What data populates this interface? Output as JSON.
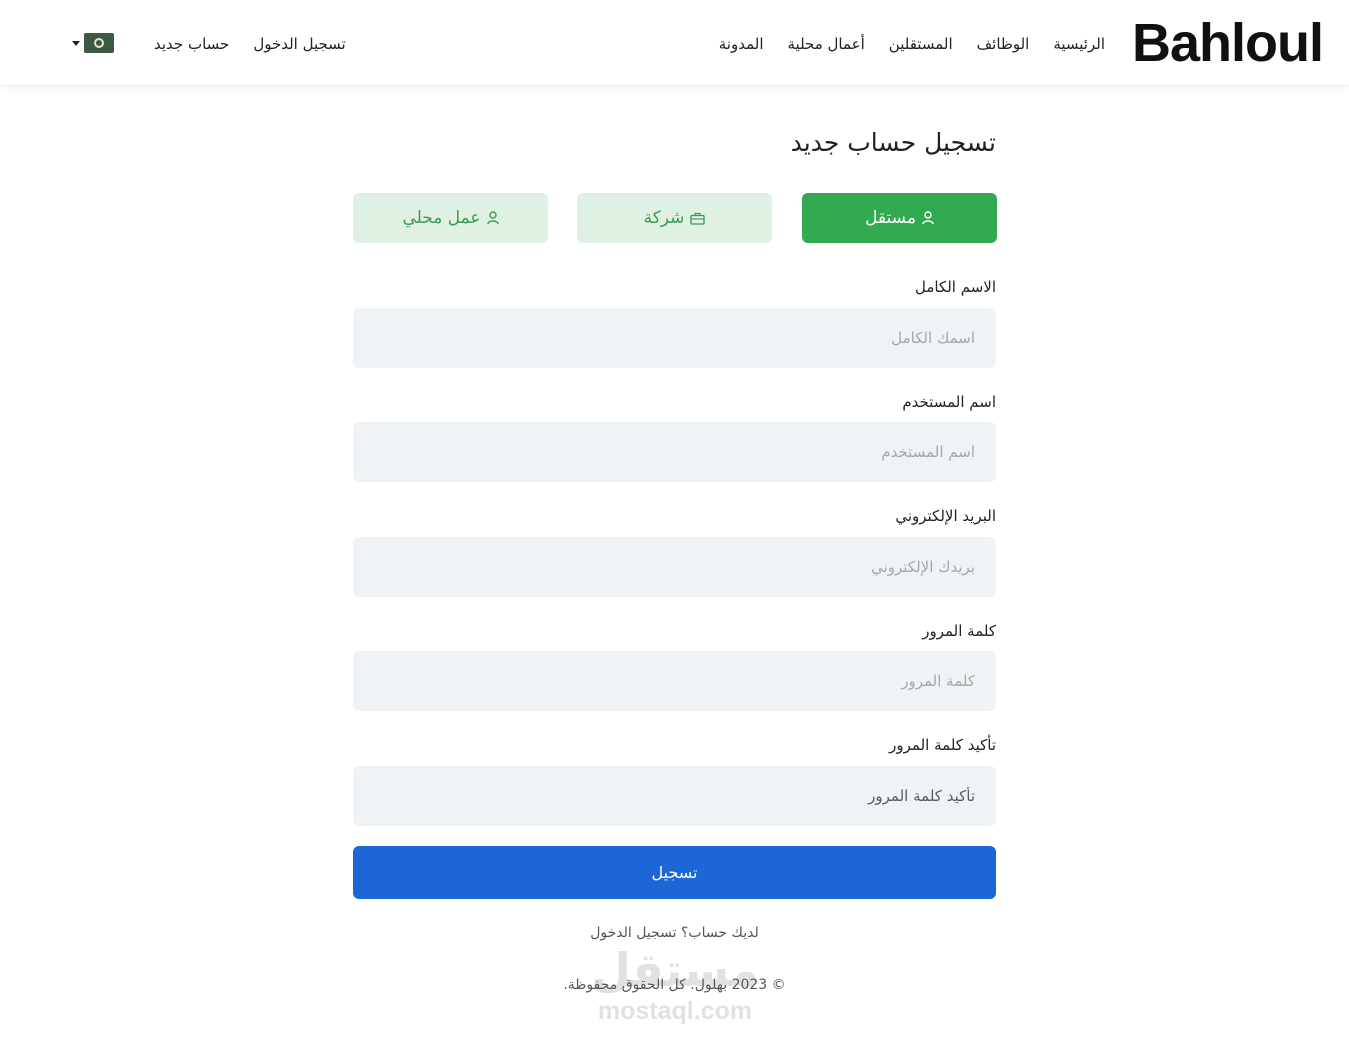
{
  "header": {
    "logo_text": "Bahloul",
    "nav": [
      {
        "label": "الرئيسية"
      },
      {
        "label": "الوظائف"
      },
      {
        "label": "المستقلين"
      },
      {
        "label": "أعمال محلية"
      },
      {
        "label": "المدونة"
      }
    ],
    "auth": {
      "login": "تسجيل الدخول",
      "register": "حساب جديد"
    },
    "language": {
      "flag_icon": "arabic-flag-icon"
    }
  },
  "page": {
    "title": "تسجيل حساب جديد"
  },
  "account_types": [
    {
      "label": "مستقل",
      "icon": "user-icon",
      "selected": true
    },
    {
      "label": "شركة",
      "icon": "briefcase-icon",
      "selected": false
    },
    {
      "label": "عمل محلي",
      "icon": "user-icon",
      "selected": false
    }
  ],
  "form": {
    "full_name": {
      "label": "الاسم الكامل",
      "placeholder": "اسمك الكامل"
    },
    "username": {
      "label": "اسم المستخدم",
      "placeholder": "اسم المستخدم"
    },
    "email": {
      "label": "البريد الإلكتروني",
      "placeholder": "بريدك الإلكتروني"
    },
    "password": {
      "label": "كلمة المرور",
      "placeholder": "كلمة المرور"
    },
    "confirm_password": {
      "label": "تأكيد كلمة المرور",
      "placeholder": "تأكيد كلمة المرور"
    },
    "submit_label": "تسجيل"
  },
  "footer": {
    "have_account": "لديك حساب؟ تسجيل الدخول",
    "copyright": "© 2023 بهلول. كل الحقوق محفوظة."
  },
  "watermark": {
    "arabic": "مستقل",
    "latin": "mostaql.com"
  },
  "colors": {
    "primary_green": "#33a951",
    "light_green": "#dff1e2",
    "submit_blue": "#1c66d6",
    "input_bg": "#eff3f6"
  }
}
